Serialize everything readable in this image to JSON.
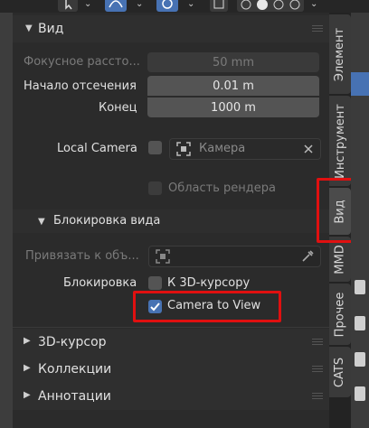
{
  "panel": {
    "view_section": {
      "title": "Вид",
      "focal_length": {
        "label": "Фокусное рассто...",
        "value": "50 mm"
      },
      "clip_start": {
        "label": "Начало отсечения",
        "value": "0.01 m"
      },
      "clip_end": {
        "label": "Конец",
        "value": "1000 m"
      },
      "local_camera": {
        "label": "Local Camera",
        "placeholder": "Камера"
      },
      "render_region": {
        "label": "Область рендера"
      }
    },
    "view_lock": {
      "title": "Блокировка вида",
      "lock_to_object": {
        "label": "Привязать к объ..."
      },
      "lock_label": "Блокировка",
      "lock_to_cursor": {
        "label": "К 3D-курсору",
        "checked": false
      },
      "camera_to_view": {
        "label": "Camera to View",
        "checked": true
      }
    },
    "collapsed_sections": [
      "3D-курсор",
      "Коллекции",
      "Аннотации"
    ]
  },
  "tabs": [
    "Элемент",
    "Инструмент",
    "Вид",
    "MMD",
    "Прочее",
    "CATS"
  ],
  "active_tab": "Вид",
  "colors": {
    "accent": "#4772b3",
    "highlight": "#e01010",
    "panel_bg": "#2b2b2b"
  },
  "icons": [
    "cursor-icon",
    "curve-icon",
    "overlay-icon",
    "xray-icon",
    "shading-icons",
    "eyedropper-icon",
    "close-icon",
    "object-icon",
    "checkmark-icon"
  ]
}
